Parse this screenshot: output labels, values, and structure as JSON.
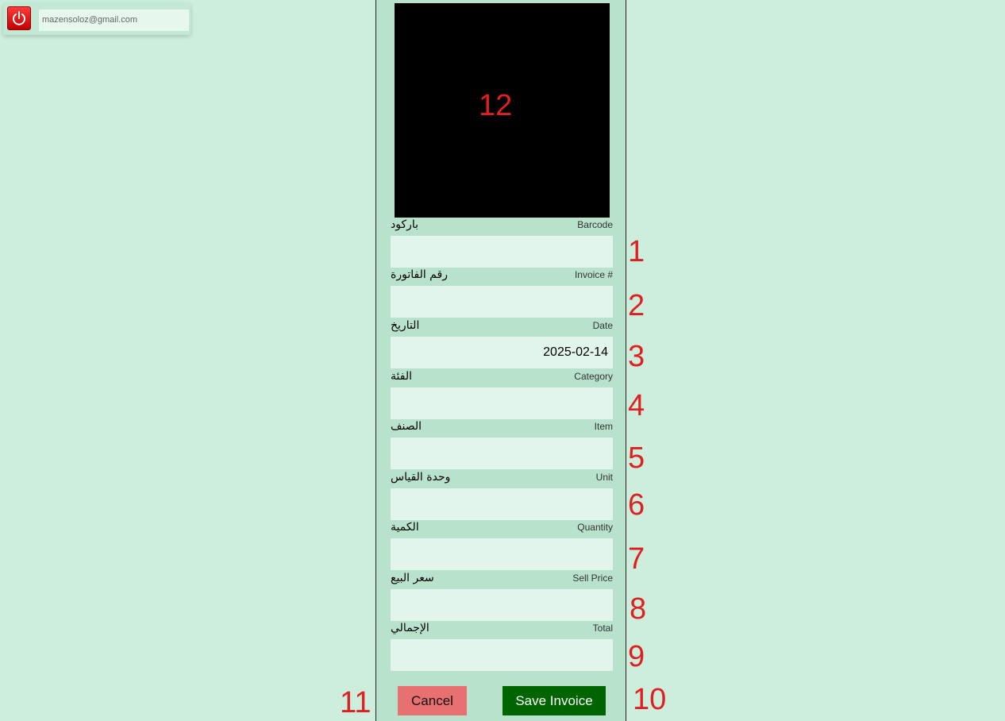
{
  "user": {
    "email": "mazensoloz@gmail.com",
    "power_icon": "power-icon"
  },
  "camera": {
    "annotation": "12"
  },
  "fields": [
    {
      "ar": "باركود",
      "en": "Barcode",
      "value": "",
      "annotation": "1"
    },
    {
      "ar": "رقم الفاتورة",
      "en": "Invoice #",
      "value": "",
      "annotation": "2"
    },
    {
      "ar": "التاريخ",
      "en": "Date",
      "value": "2025-02-14",
      "annotation": "3"
    },
    {
      "ar": "الفئة",
      "en": "Category",
      "value": "",
      "annotation": "4"
    },
    {
      "ar": "الصنف",
      "en": "Item",
      "value": "",
      "annotation": "5"
    },
    {
      "ar": "وحدة القياس",
      "en": "Unit",
      "value": "",
      "annotation": "6"
    },
    {
      "ar": "الكمية",
      "en": "Quantity",
      "value": "",
      "annotation": "7"
    },
    {
      "ar": "سعر البيع",
      "en": "Sell Price",
      "value": "",
      "annotation": "8"
    },
    {
      "ar": "الإجمالي",
      "en": "Total",
      "value": "",
      "annotation": "9"
    }
  ],
  "buttons": {
    "cancel": "Cancel",
    "save": "Save Invoice",
    "save_annotation": "10",
    "cancel_annotation": "11"
  },
  "colors": {
    "page_bg": "#cdeedd",
    "panel_bg": "#b9e2cc",
    "input_bg": "#e2f5ec",
    "annotation": "#e02020",
    "save_button": "#006400",
    "cancel_button": "#e87070"
  }
}
